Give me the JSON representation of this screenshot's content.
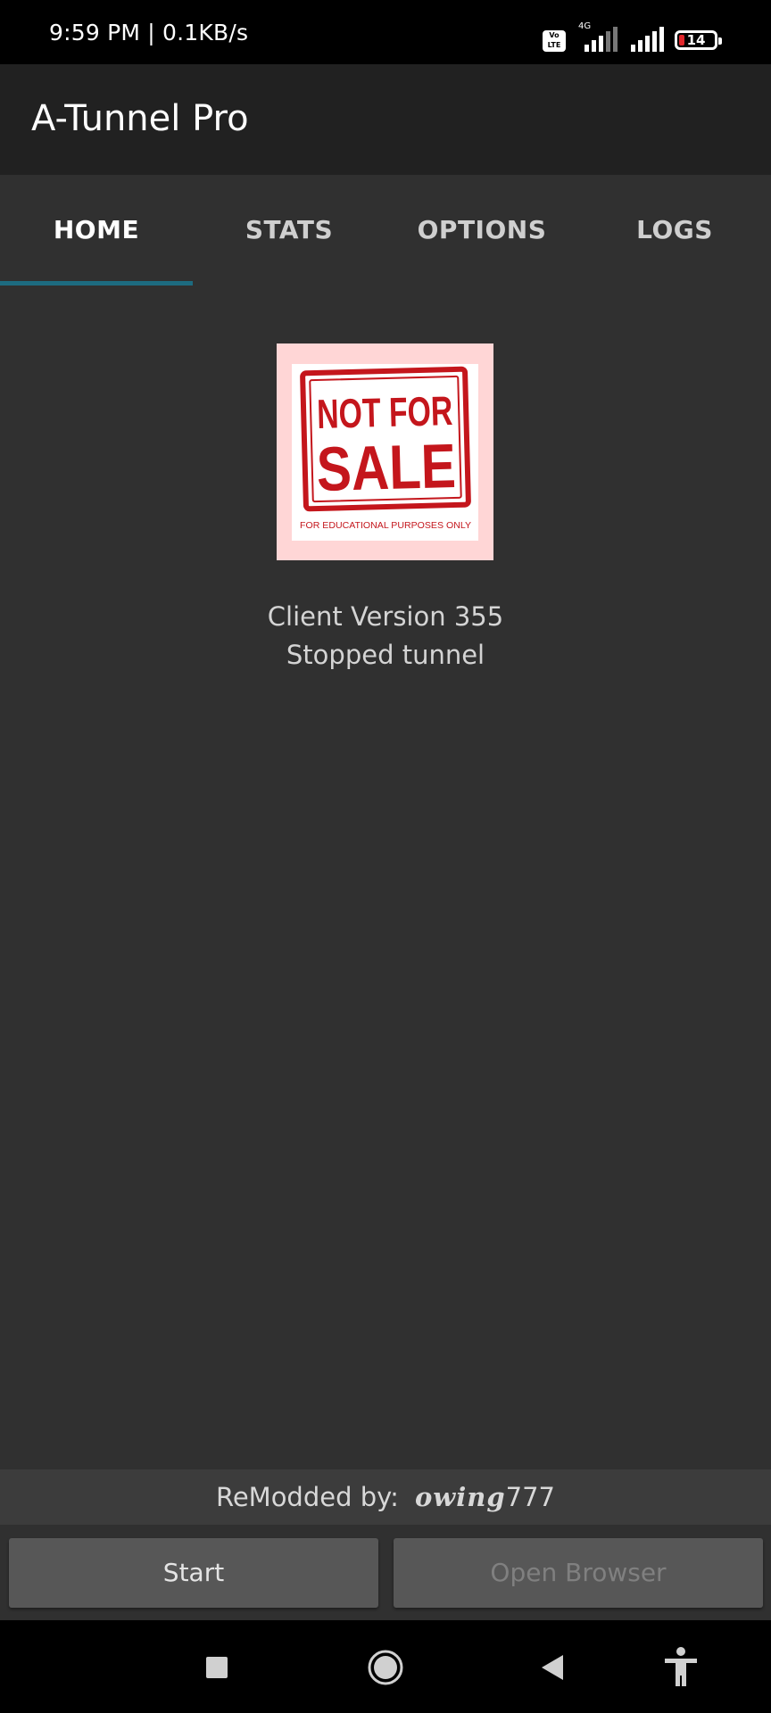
{
  "status_bar": {
    "time": "9:59 PM | 0.1KB/s",
    "volte": "Vo LTE",
    "network_type": "4G",
    "battery_level": "14"
  },
  "app_bar": {
    "title": "A-Tunnel Pro"
  },
  "tabs": [
    {
      "label": "HOME",
      "active": true
    },
    {
      "label": "STATS",
      "active": false
    },
    {
      "label": "OPTIONS",
      "active": false
    },
    {
      "label": "LOGS",
      "active": false
    }
  ],
  "logo": {
    "line1": "NOT FOR",
    "line2": "SALE",
    "caption": "FOR EDUCATIONAL PURPOSES ONLY"
  },
  "info": {
    "version": "Client Version 355",
    "status": "Stopped tunnel"
  },
  "remod": {
    "label": "ReModded by:",
    "name_script": "owing",
    "name_digits": "777"
  },
  "buttons": {
    "start": "Start",
    "open_browser": "Open Browser"
  },
  "colors": {
    "background": "#303030",
    "app_bar": "#212121",
    "tab_indicator": "#1d6b80",
    "stamp_red": "#c4161c",
    "button": "#575757"
  }
}
